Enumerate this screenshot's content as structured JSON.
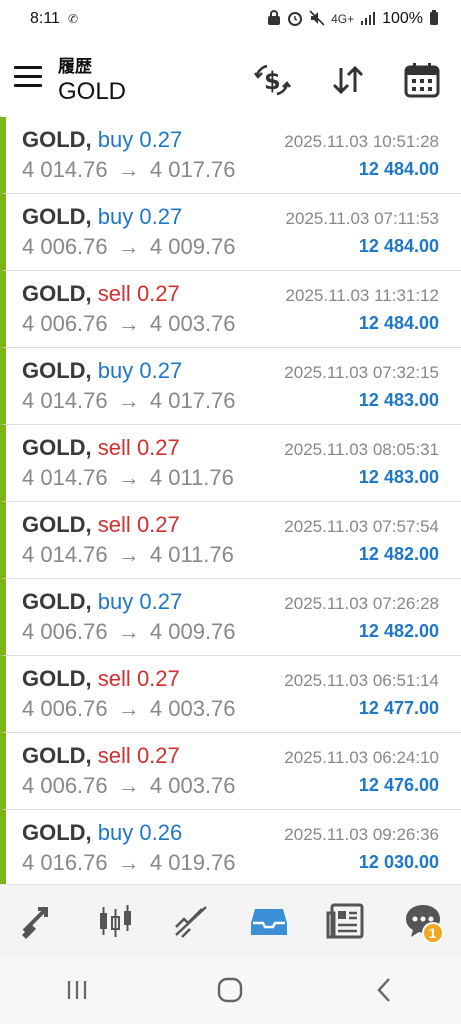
{
  "status_bar": {
    "time": "8:11",
    "network": "4G+",
    "battery": "100%"
  },
  "header": {
    "subtitle": "履歴",
    "title": "GOLD",
    "icons": [
      "currency-exchange-icon",
      "sort-icon",
      "calendar-icon"
    ]
  },
  "trades": [
    {
      "symbol": "GOLD,",
      "side": "buy",
      "volume": "0.27",
      "time": "2025.11.03 10:51:28",
      "open": "4 014.76",
      "close": "4 017.76",
      "balance": "12 484.00"
    },
    {
      "symbol": "GOLD,",
      "side": "buy",
      "volume": "0.27",
      "time": "2025.11.03 07:11:53",
      "open": "4 006.76",
      "close": "4 009.76",
      "balance": "12 484.00"
    },
    {
      "symbol": "GOLD,",
      "side": "sell",
      "volume": "0.27",
      "time": "2025.11.03 11:31:12",
      "open": "4 006.76",
      "close": "4 003.76",
      "balance": "12 484.00"
    },
    {
      "symbol": "GOLD,",
      "side": "buy",
      "volume": "0.27",
      "time": "2025.11.03 07:32:15",
      "open": "4 014.76",
      "close": "4 017.76",
      "balance": "12 483.00"
    },
    {
      "symbol": "GOLD,",
      "side": "sell",
      "volume": "0.27",
      "time": "2025.11.03 08:05:31",
      "open": "4 014.76",
      "close": "4 011.76",
      "balance": "12 483.00"
    },
    {
      "symbol": "GOLD,",
      "side": "sell",
      "volume": "0.27",
      "time": "2025.11.03 07:57:54",
      "open": "4 014.76",
      "close": "4 011.76",
      "balance": "12 482.00"
    },
    {
      "symbol": "GOLD,",
      "side": "buy",
      "volume": "0.27",
      "time": "2025.11.03 07:26:28",
      "open": "4 006.76",
      "close": "4 009.76",
      "balance": "12 482.00"
    },
    {
      "symbol": "GOLD,",
      "side": "sell",
      "volume": "0.27",
      "time": "2025.11.03 06:51:14",
      "open": "4 006.76",
      "close": "4 003.76",
      "balance": "12 477.00"
    },
    {
      "symbol": "GOLD,",
      "side": "sell",
      "volume": "0.27",
      "time": "2025.11.03 06:24:10",
      "open": "4 006.76",
      "close": "4 003.76",
      "balance": "12 476.00"
    },
    {
      "symbol": "GOLD,",
      "side": "buy",
      "volume": "0.26",
      "time": "2025.11.03 09:26:36",
      "open": "4 016.76",
      "close": "4 019.76",
      "balance": "12 030.00"
    }
  ],
  "arrow": "→",
  "bottom_nav": {
    "items": [
      "trade-icon",
      "chart-candles-icon",
      "trend-icon",
      "history-inbox-icon",
      "news-icon",
      "chat-icon"
    ],
    "active": "history-inbox-icon",
    "chat_badge": "1"
  },
  "colors": {
    "buy": "#1f77c8",
    "sell": "#d22f2f",
    "profit_bar": "#7cb518",
    "balance": "#1f77c8",
    "active_nav": "#3a8fd6"
  }
}
